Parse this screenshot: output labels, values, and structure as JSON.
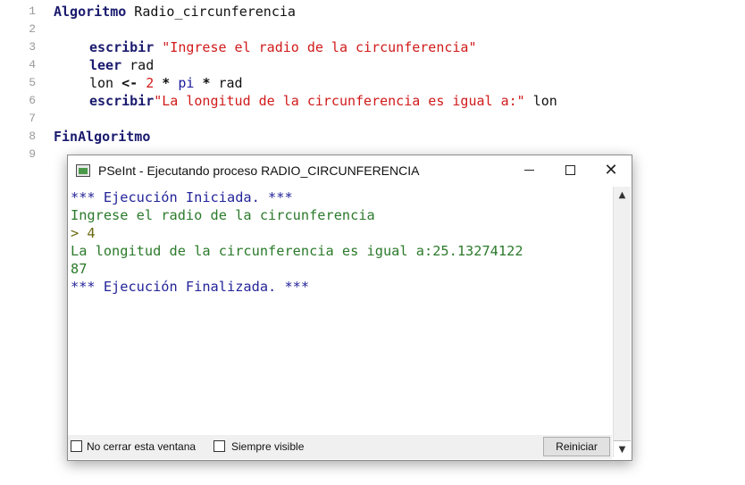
{
  "editor": {
    "line_numbers": [
      "1",
      "2",
      "3",
      "4",
      "5",
      "6",
      "7",
      "8",
      "9"
    ],
    "line1": {
      "kw": "Algoritmo",
      "rest": " Radio_circunferencia"
    },
    "line3": {
      "kw": "escribir",
      "str": "\"Ingrese el radio de la circunferencia\""
    },
    "line4": {
      "kw": "leer",
      "rest": " rad"
    },
    "line5": {
      "a": "lon ",
      "op1": "<-",
      "sp1": " ",
      "num": "2",
      "sp2": " ",
      "op2": "*",
      "sp3": " ",
      "fn": "pi",
      "sp4": " ",
      "op3": "*",
      "rest": " rad"
    },
    "line6": {
      "kw": "escribir",
      "str": "\"La longitud de la circunferencia es igual a:\"",
      "rest": " lon"
    },
    "line8": {
      "kw": "FinAlgoritmo"
    }
  },
  "window": {
    "title": "PSeInt - Ejecutando proceso RADIO_CIRCUNFERENCIA",
    "minimize_label": "",
    "close_label": "✕",
    "console": [
      "*** Ejecución Iniciada. ***",
      "Ingrese el radio de la circunferencia",
      "> 4",
      "La longitud de la circunferencia es igual a:25.13274122",
      "87",
      "*** Ejecución Finalizada. ***"
    ],
    "no_cerrar_label": "No cerrar esta ventana",
    "siempre_visible_label": "Siempre visible",
    "reiniciar_label": "Reiniciar",
    "scroll_up": "▲",
    "scroll_down": "▼"
  },
  "colors": {
    "keyword": "#1a1a6e",
    "string": "#d11a1a",
    "console_blue": "#24249a",
    "console_green": "#2b7a2b",
    "console_input": "#6a6a10"
  }
}
